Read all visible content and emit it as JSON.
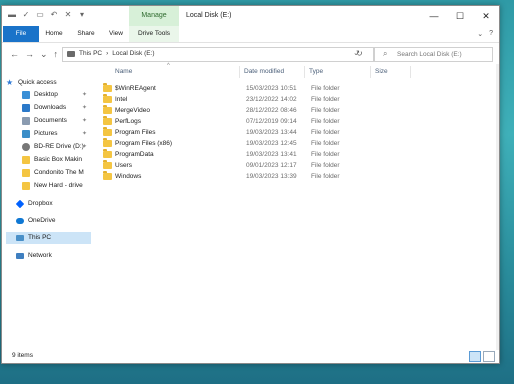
{
  "window": {
    "title": "Local Disk (E:)",
    "contextual_group": "Manage",
    "controls": [
      "—",
      "☐",
      "✕"
    ]
  },
  "quick_access_toolbar": [
    "▬",
    "✓",
    "▭",
    "↶",
    "✕",
    "▾"
  ],
  "ribbon": {
    "tabs": [
      "File",
      "Home",
      "Share",
      "View",
      "Drive Tools"
    ],
    "right": [
      "⌄",
      "?"
    ]
  },
  "nav_buttons": [
    "←",
    "→",
    "⌄",
    "↑"
  ],
  "address": {
    "crumbs": [
      "This PC",
      "›",
      "Local Disk (E:)"
    ],
    "dropdown": "⌄",
    "refresh": "↻"
  },
  "search": {
    "placeholder": "Search Local Disk (E:)"
  },
  "sidebar": {
    "items": [
      {
        "label": "Quick access",
        "icon": "star-icon",
        "color": "#2f7ad6",
        "pin": ""
      },
      {
        "label": "Desktop",
        "icon": "desktop-icon",
        "color": "#3a8fd6",
        "pin": "✦"
      },
      {
        "label": "Downloads",
        "icon": "downloads-icon",
        "color": "#2b79c9",
        "pin": "✦"
      },
      {
        "label": "Documents",
        "icon": "documents-icon",
        "color": "#8a9bb0",
        "pin": "✦"
      },
      {
        "label": "Pictures",
        "icon": "pictures-icon",
        "color": "#3b8ec8",
        "pin": "✦"
      },
      {
        "label": "BD-RE Drive (D:)",
        "icon": "disc-drive-icon",
        "color": "#777777",
        "pin": "✦"
      },
      {
        "label": "Basic Box Makin",
        "icon": "folder-icon",
        "color": "#f4c542",
        "pin": ""
      },
      {
        "label": "Condonito The M",
        "icon": "folder-icon",
        "color": "#f4c542",
        "pin": ""
      },
      {
        "label": "New Hard - drive",
        "icon": "folder-icon",
        "color": "#f4c542",
        "pin": ""
      },
      {
        "label": "Dropbox",
        "icon": "dropbox-icon",
        "color": "#0061fe",
        "pin": ""
      },
      {
        "label": "OneDrive",
        "icon": "onedrive-icon",
        "color": "#0f78d4",
        "pin": ""
      },
      {
        "label": "This PC",
        "icon": "pc-icon",
        "color": "#4a90c8",
        "pin": ""
      },
      {
        "label": "Network",
        "icon": "network-icon",
        "color": "#3f7fc0",
        "pin": ""
      }
    ]
  },
  "columns": [
    "Name",
    "Date modified",
    "Type",
    "Size"
  ],
  "files": [
    {
      "name": "$WinREAgent",
      "date": "15/03/2023 10:51",
      "type": "File folder"
    },
    {
      "name": "Intel",
      "date": "23/12/2022 14:02",
      "type": "File folder"
    },
    {
      "name": "MergeVideo",
      "date": "28/12/2022 08:46",
      "type": "File folder"
    },
    {
      "name": "PerfLogs",
      "date": "07/12/2019 09:14",
      "type": "File folder"
    },
    {
      "name": "Program Files",
      "date": "19/03/2023 13:44",
      "type": "File folder"
    },
    {
      "name": "Program Files (x86)",
      "date": "19/03/2023 12:45",
      "type": "File folder"
    },
    {
      "name": "ProgramData",
      "date": "19/03/2023 13:41",
      "type": "File folder"
    },
    {
      "name": "Users",
      "date": "09/01/2023 12:17",
      "type": "File folder"
    },
    {
      "name": "Windows",
      "date": "19/03/2023 13:39",
      "type": "File folder"
    }
  ],
  "status": {
    "count": "9 items"
  },
  "colors": {
    "accent": "#1a73c9",
    "selection": "#cce4f7",
    "folder": "#f4c542"
  }
}
